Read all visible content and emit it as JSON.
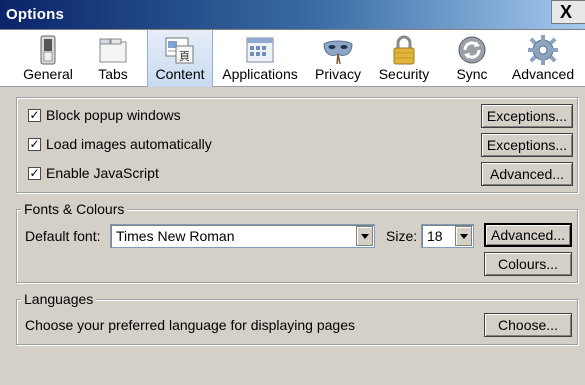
{
  "window": {
    "title": "Options",
    "close_glyph": "X"
  },
  "toolbar": {
    "items": [
      {
        "label": "General",
        "icon": "switch-icon"
      },
      {
        "label": "Tabs",
        "icon": "tabs-icon"
      },
      {
        "label": "Content",
        "icon": "content-icon",
        "selected": true
      },
      {
        "label": "Applications",
        "icon": "applications-icon"
      },
      {
        "label": "Privacy",
        "icon": "mask-icon"
      },
      {
        "label": "Security",
        "icon": "padlock-icon"
      },
      {
        "label": "Sync",
        "icon": "sync-icon"
      },
      {
        "label": "Advanced",
        "icon": "gear-icon"
      }
    ]
  },
  "content_group": {
    "block_popups": {
      "label": "Block popup windows",
      "checked": true,
      "button": "Exceptions..."
    },
    "load_images": {
      "label": "Load images automatically",
      "checked": true,
      "button": "Exceptions..."
    },
    "javascript": {
      "label": "Enable JavaScript",
      "checked": true,
      "button": "Advanced..."
    }
  },
  "fonts_group": {
    "legend": "Fonts & Colours",
    "default_font_label": "Default font:",
    "default_font_value": "Times New Roman",
    "size_label": "Size:",
    "size_value": "18",
    "advanced_button": "Advanced...",
    "colours_button": "Colours..."
  },
  "languages_group": {
    "legend": "Languages",
    "description": "Choose your preferred language for displaying pages",
    "choose_button": "Choose..."
  }
}
